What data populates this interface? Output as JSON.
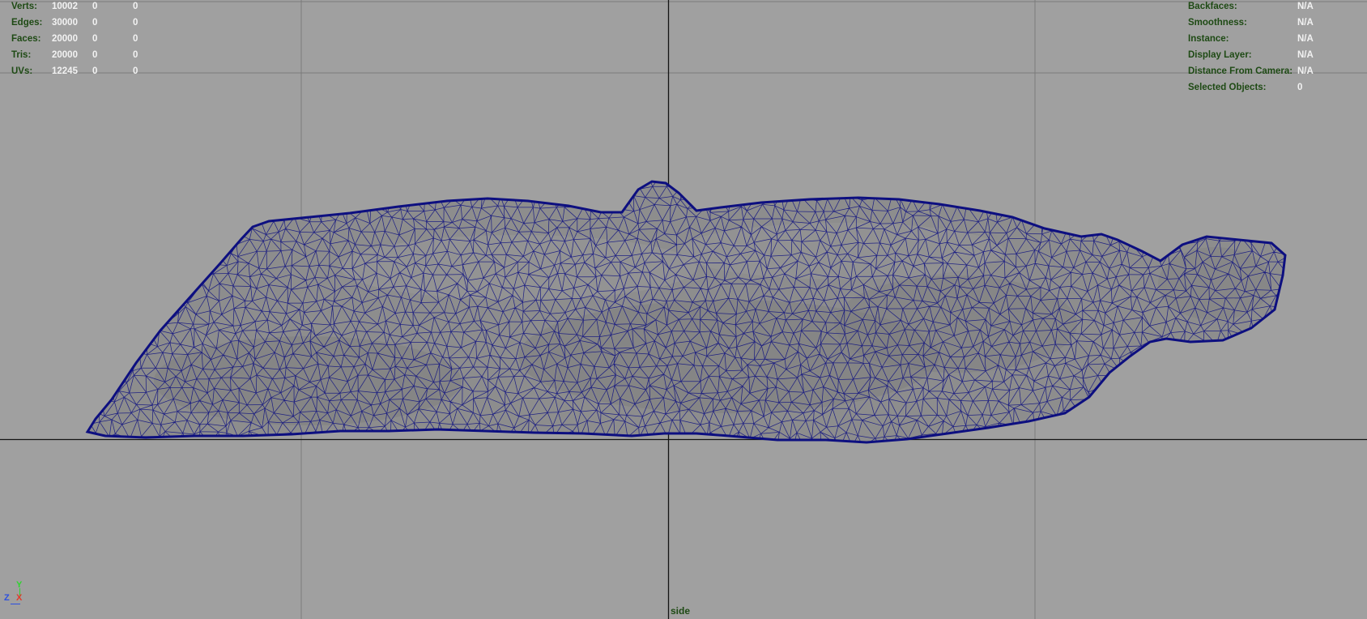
{
  "viewport": {
    "camera": "side",
    "background_color": "#a0a0a0",
    "wireframe_color": "#0d0f80",
    "grid_color": "#7b7b7b",
    "axis_color": "#141414"
  },
  "heads_up_display": {
    "poly_count": {
      "rows": [
        {
          "label": "Verts:",
          "values": [
            "10002",
            "0",
            "0"
          ]
        },
        {
          "label": "Edges:",
          "values": [
            "30000",
            "0",
            "0"
          ]
        },
        {
          "label": "Faces:",
          "values": [
            "20000",
            "0",
            "0"
          ]
        },
        {
          "label": "Tris:",
          "values": [
            "20000",
            "0",
            "0"
          ]
        },
        {
          "label": "UVs:",
          "values": [
            "12245",
            "0",
            "0"
          ]
        }
      ]
    },
    "object_details": {
      "rows": [
        {
          "label": "Backfaces:",
          "value": "N/A"
        },
        {
          "label": "Smoothness:",
          "value": "N/A"
        },
        {
          "label": "Instance:",
          "value": "N/A"
        },
        {
          "label": "Display Layer:",
          "value": "N/A"
        },
        {
          "label": "Distance From Camera:",
          "value": "N/A"
        },
        {
          "label": "Selected Objects:",
          "value": "0"
        }
      ]
    },
    "label_color": "#1e4a14",
    "value_color": "#f2f2f2"
  },
  "axis_gizmo": {
    "icon": "axis-orientation-icon",
    "y_label": "Y",
    "z_label": "Z",
    "x_label": "X",
    "y_color": "#2fd42f",
    "z_color": "#2b4fe0",
    "x_color": "#e03a2a"
  }
}
